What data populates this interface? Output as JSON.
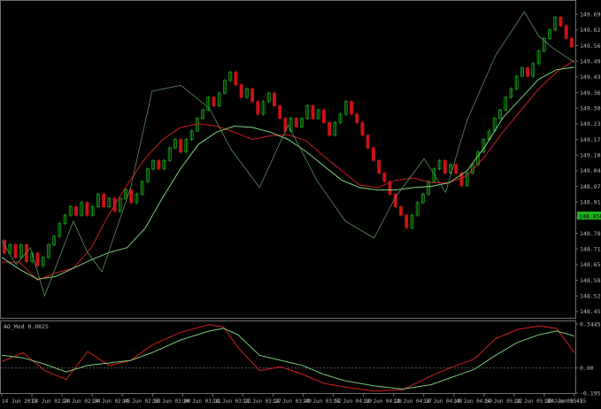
{
  "colors": {
    "background": "#000000",
    "frame": "#6e6e6e",
    "axis_text": "#b9b9b9",
    "bull_candle": "#18a018",
    "bear_candle": "#c81414",
    "zigzag": "#5e8f5e",
    "ma_fast": "#c81e1e",
    "ma_slow": "#7ed17e",
    "osc_main": "#d42020",
    "osc_signal": "#7ec87e",
    "osc_zero": "#777777",
    "price_tag_bg": "#1eb41e",
    "price_tag_text": "#000000"
  },
  "chart_data": [
    {
      "type": "line",
      "description_role": "price",
      "ylim": [
        148.425,
        149.72
      ],
      "ytick_labels": [
        "149.690",
        "149.625",
        "149.560",
        "149.495",
        "149.430",
        "149.365",
        "149.300",
        "149.235",
        "149.170",
        "149.105",
        "149.040",
        "148.975",
        "148.910",
        "148.845",
        "148.780",
        "148.715",
        "148.650",
        "148.585",
        "148.520",
        "148.455"
      ],
      "current_price": "148.858",
      "x": [
        "14 Jun 2013",
        "14 Jun 02:24",
        "14 Jun 02:34",
        "14 Jun 02:45",
        "14 Jun 02:53",
        "14 Jun 03:00",
        "14 Jun 03:11",
        "14 Jun 03:21",
        "14 Jun 03:27",
        "14 Jun 03:40",
        "14 Jun 03:52",
        "14 Jun 04:10",
        "14 Jun 04:28",
        "14 Jun 04:37",
        "14 Jun 04:48",
        "14 Jun 04:59",
        "14 Jun 05:12",
        "14 Jun 05:30",
        "14 Jun 05:41",
        "14 Jun 05:55"
      ],
      "candles": {
        "start": 148.75,
        "brick": 0.0175,
        "moves": [
          -3,
          2,
          -3,
          3,
          -4,
          2,
          -3,
          2,
          3,
          2,
          3,
          2,
          2,
          -2,
          3,
          -3,
          2,
          3,
          -3,
          2,
          -3,
          3,
          2,
          -3,
          2,
          3,
          3,
          2,
          -2,
          2,
          3,
          2,
          -3,
          3,
          2,
          3,
          2,
          3,
          -2,
          3,
          3,
          2,
          -3,
          -3,
          2,
          -3,
          -3,
          3,
          2,
          -3,
          -3,
          -3,
          3,
          -2,
          2,
          3,
          -3,
          2,
          -3,
          -3,
          3,
          2,
          3,
          -3,
          -2,
          -3,
          -3,
          -3,
          -3,
          -2,
          -3,
          -3,
          -2,
          -3,
          3,
          3,
          2,
          3,
          3,
          2,
          -3,
          2,
          -2,
          -3,
          3,
          2,
          3,
          3,
          2,
          3,
          2,
          3,
          2,
          3,
          2,
          -2,
          3,
          3,
          3,
          2,
          3,
          -2,
          -3,
          -2
        ]
      },
      "series": [
        {
          "kind": "ma_fast",
          "values": [
            [
              0,
              148.66
            ],
            [
              5,
              148.66
            ],
            [
              10,
              148.585
            ],
            [
              15,
              148.615
            ],
            [
              20,
              148.635
            ],
            [
              25,
              148.72
            ],
            [
              30,
              148.86
            ],
            [
              35,
              148.98
            ],
            [
              40,
              149.09
            ],
            [
              45,
              149.17
            ],
            [
              50,
              149.22
            ],
            [
              55,
              149.235
            ],
            [
              60,
              149.225
            ],
            [
              65,
              149.2
            ],
            [
              70,
              149.17
            ],
            [
              75,
              149.185
            ],
            [
              80,
              149.19
            ],
            [
              85,
              149.165
            ],
            [
              90,
              149.1
            ],
            [
              95,
              149.04
            ],
            [
              100,
              148.98
            ],
            [
              105,
              148.97
            ],
            [
              110,
              149.0
            ],
            [
              115,
              149.01
            ],
            [
              120,
              148.99
            ],
            [
              125,
              148.99
            ],
            [
              130,
              149.02
            ],
            [
              135,
              149.1
            ],
            [
              140,
              149.2
            ],
            [
              145,
              149.29
            ],
            [
              150,
              149.38
            ],
            [
              155,
              149.45
            ],
            [
              160,
              149.5
            ]
          ]
        },
        {
          "kind": "ma_slow",
          "values": [
            [
              0,
              148.68
            ],
            [
              5,
              148.63
            ],
            [
              10,
              148.59
            ],
            [
              15,
              148.6
            ],
            [
              20,
              148.635
            ],
            [
              25,
              148.67
            ],
            [
              30,
              148.7
            ],
            [
              35,
              148.72
            ],
            [
              40,
              148.8
            ],
            [
              45,
              148.93
            ],
            [
              50,
              149.05
            ],
            [
              55,
              149.15
            ],
            [
              60,
              149.2
            ],
            [
              65,
              149.225
            ],
            [
              70,
              149.22
            ],
            [
              75,
              149.2
            ],
            [
              80,
              149.17
            ],
            [
              85,
              149.12
            ],
            [
              90,
              149.06
            ],
            [
              95,
              149.0
            ],
            [
              100,
              148.97
            ],
            [
              105,
              148.96
            ],
            [
              110,
              148.96
            ],
            [
              115,
              148.97
            ],
            [
              120,
              148.975
            ],
            [
              125,
              148.99
            ],
            [
              130,
              149.04
            ],
            [
              135,
              149.14
            ],
            [
              140,
              149.26
            ],
            [
              145,
              149.34
            ],
            [
              150,
              149.42
            ],
            [
              155,
              149.46
            ],
            [
              160,
              149.47
            ]
          ]
        },
        {
          "kind": "zigzag",
          "values": [
            [
              0,
              148.75
            ],
            [
              4,
              148.65
            ],
            [
              8,
              148.72
            ],
            [
              12,
              148.52
            ],
            [
              20,
              148.83
            ],
            [
              24,
              148.7
            ],
            [
              28,
              148.62
            ],
            [
              36,
              148.97
            ],
            [
              42,
              149.37
            ],
            [
              50,
              149.395
            ],
            [
              58,
              149.3
            ],
            [
              64,
              149.13
            ],
            [
              72,
              148.97
            ],
            [
              80,
              149.23
            ],
            [
              88,
              149.0
            ],
            [
              96,
              148.83
            ],
            [
              104,
              148.76
            ],
            [
              110,
              148.93
            ],
            [
              118,
              149.09
            ],
            [
              124,
              148.95
            ],
            [
              130,
              149.25
            ],
            [
              138,
              149.52
            ],
            [
              146,
              149.7
            ],
            [
              150,
              149.6
            ],
            [
              154,
              149.55
            ],
            [
              160,
              149.49
            ]
          ]
        }
      ]
    },
    {
      "type": "line",
      "description_role": "oscillator",
      "title": "AO_Mod 0.0825",
      "ylim": [
        -0.1959,
        0.3445
      ],
      "ytick_labels": [
        "0.3445",
        "0.00",
        "-0.1959"
      ],
      "series": [
        {
          "kind": "osc_main",
          "values": [
            [
              0,
              0.05
            ],
            [
              6,
              0.12
            ],
            [
              12,
              -0.02
            ],
            [
              18,
              -0.09
            ],
            [
              24,
              0.13
            ],
            [
              30,
              0.02
            ],
            [
              36,
              0.06
            ],
            [
              42,
              0.18
            ],
            [
              50,
              0.28
            ],
            [
              58,
              0.34
            ],
            [
              62,
              0.32
            ],
            [
              66,
              0.16
            ],
            [
              72,
              -0.02
            ],
            [
              78,
              0.01
            ],
            [
              84,
              -0.05
            ],
            [
              90,
              -0.12
            ],
            [
              96,
              -0.15
            ],
            [
              104,
              -0.18
            ],
            [
              112,
              -0.17
            ],
            [
              120,
              -0.06
            ],
            [
              126,
              0.01
            ],
            [
              132,
              0.07
            ],
            [
              138,
              0.23
            ],
            [
              144,
              0.3
            ],
            [
              150,
              0.33
            ],
            [
              155,
              0.31
            ],
            [
              160,
              0.12
            ]
          ]
        },
        {
          "kind": "osc_signal",
          "values": [
            [
              0,
              0.1
            ],
            [
              6,
              0.08
            ],
            [
              12,
              0.03
            ],
            [
              18,
              -0.03
            ],
            [
              24,
              0.02
            ],
            [
              30,
              0.04
            ],
            [
              36,
              0.06
            ],
            [
              42,
              0.12
            ],
            [
              50,
              0.22
            ],
            [
              58,
              0.29
            ],
            [
              62,
              0.31
            ],
            [
              66,
              0.26
            ],
            [
              72,
              0.1
            ],
            [
              78,
              0.06
            ],
            [
              84,
              0.02
            ],
            [
              90,
              -0.05
            ],
            [
              96,
              -0.1
            ],
            [
              104,
              -0.14
            ],
            [
              112,
              -0.165
            ],
            [
              120,
              -0.13
            ],
            [
              126,
              -0.07
            ],
            [
              132,
              -0.01
            ],
            [
              138,
              0.1
            ],
            [
              144,
              0.2
            ],
            [
              150,
              0.26
            ],
            [
              155,
              0.29
            ],
            [
              160,
              0.25
            ]
          ]
        }
      ]
    }
  ]
}
